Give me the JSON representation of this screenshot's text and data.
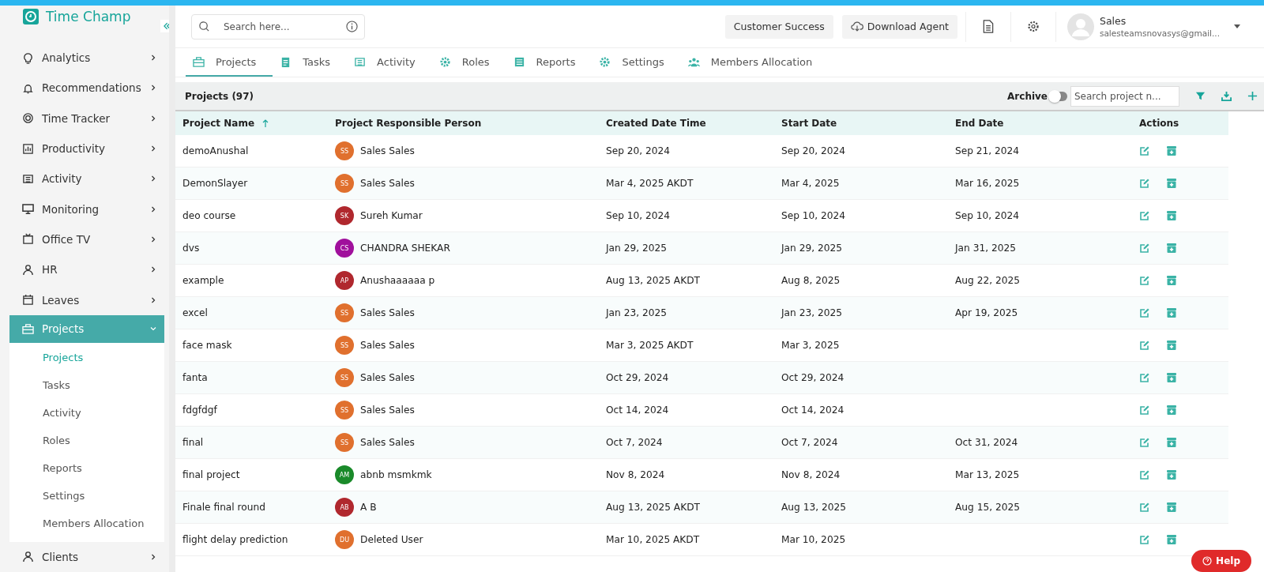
{
  "brand": {
    "name": "Time Champ"
  },
  "search": {
    "placeholder": "Search here..."
  },
  "header_buttons": [
    "Customer Success",
    "Download Agent"
  ],
  "user": {
    "name": "Sales",
    "email": "salesteamsnovasys@gmail..."
  },
  "sidebar": {
    "items": [
      {
        "label": "Analytics",
        "selected": false,
        "expanded": false
      },
      {
        "label": "Recommendations",
        "selected": false,
        "expanded": false
      },
      {
        "label": "Time Tracker",
        "selected": false,
        "expanded": false
      },
      {
        "label": "Productivity",
        "selected": false,
        "expanded": false
      },
      {
        "label": "Activity",
        "selected": false,
        "expanded": false
      },
      {
        "label": "Monitoring",
        "selected": false,
        "expanded": false
      },
      {
        "label": "Office TV",
        "selected": false,
        "expanded": false
      },
      {
        "label": "HR",
        "selected": false,
        "expanded": false
      },
      {
        "label": "Leaves",
        "selected": false,
        "expanded": false
      },
      {
        "label": "Projects",
        "selected": true,
        "expanded": true,
        "children": [
          {
            "label": "Projects",
            "selected": true
          },
          {
            "label": "Tasks",
            "selected": false
          },
          {
            "label": "Activity",
            "selected": false
          },
          {
            "label": "Roles",
            "selected": false
          },
          {
            "label": "Reports",
            "selected": false
          },
          {
            "label": "Settings",
            "selected": false
          },
          {
            "label": "Members Allocation",
            "selected": false
          }
        ]
      },
      {
        "label": "Clients",
        "selected": false,
        "expanded": false
      }
    ]
  },
  "tabs": [
    {
      "label": "Projects",
      "selected": true
    },
    {
      "label": "Tasks",
      "selected": false
    },
    {
      "label": "Activity",
      "selected": false
    },
    {
      "label": "Roles",
      "selected": false
    },
    {
      "label": "Reports",
      "selected": false
    },
    {
      "label": "Settings",
      "selected": false
    },
    {
      "label": "Members Allocation",
      "selected": false
    }
  ],
  "table": {
    "title": "Projects (97)",
    "archive": {
      "label": "Archive",
      "on": false
    },
    "search_placeholder": "Search project n...",
    "columns": [
      "Project Name",
      "Project Responsible Person",
      "Created Date Time",
      "Start Date",
      "End Date",
      "Actions"
    ],
    "rows": [
      {
        "name": "demoAnushal",
        "initials": "SS",
        "color": "#e0702e",
        "person": "Sales Sales",
        "created": "Sep 20, 2024",
        "start": "Sep 20, 2024",
        "end": "Sep 21, 2024"
      },
      {
        "name": "DemonSlayer",
        "initials": "SS",
        "color": "#e0702e",
        "person": "Sales Sales",
        "created": "Mar 4, 2025 AKDT",
        "start": "Mar 4, 2025",
        "end": "Mar 16, 2025"
      },
      {
        "name": "deo course",
        "initials": "SK",
        "color": "#b0282e",
        "person": "Sureh Kumar",
        "created": "Sep 10, 2024",
        "start": "Sep 10, 2024",
        "end": "Sep 10, 2024"
      },
      {
        "name": "dvs",
        "initials": "CS",
        "color": "#a0109c",
        "person": "CHANDRA SHEKAR",
        "created": "Jan 29, 2025",
        "start": "Jan 29, 2025",
        "end": "Jan 31, 2025"
      },
      {
        "name": "example",
        "initials": "AP",
        "color": "#b0282e",
        "person": "Anushaaaaaa p",
        "created": "Aug 13, 2025 AKDT",
        "start": "Aug 8, 2025",
        "end": "Aug 22, 2025"
      },
      {
        "name": "excel",
        "initials": "SS",
        "color": "#e0702e",
        "person": "Sales Sales",
        "created": "Jan 23, 2025",
        "start": "Jan 23, 2025",
        "end": "Apr 19, 2025"
      },
      {
        "name": "face mask",
        "initials": "SS",
        "color": "#e0702e",
        "person": "Sales Sales",
        "created": "Mar 3, 2025 AKDT",
        "start": "Mar 3, 2025"
      },
      {
        "name": "fanta",
        "initials": "SS",
        "color": "#e0702e",
        "person": "Sales Sales",
        "created": "Oct 29, 2024",
        "start": "Oct 29, 2024"
      },
      {
        "name": "fdgfdgf",
        "initials": "SS",
        "color": "#e0702e",
        "person": "Sales Sales",
        "created": "Oct 14, 2024",
        "start": "Oct 14, 2024"
      },
      {
        "name": "final",
        "initials": "SS",
        "color": "#e0702e",
        "person": "Sales Sales",
        "created": "Oct 7, 2024",
        "start": "Oct 7, 2024",
        "end": "Oct 31, 2024"
      },
      {
        "name": "final project",
        "initials": "AM",
        "color": "#1a8a2a",
        "person": "abnb msmkmk",
        "created": "Nov 8, 2024",
        "start": "Nov 8, 2024",
        "end": "Mar 13, 2025"
      },
      {
        "name": "Finale final round",
        "initials": "AB",
        "color": "#b0282e",
        "person": "A B",
        "created": "Aug 13, 2025 AKDT",
        "start": "Aug 13, 2025",
        "end": "Aug 15, 2025"
      },
      {
        "name": "flight delay prediction",
        "initials": "DU",
        "color": "#e0702e",
        "person": "Deleted User",
        "created": "Mar 10, 2025 AKDT",
        "start": "Mar 10, 2025"
      }
    ]
  },
  "help": {
    "label": "Help"
  }
}
